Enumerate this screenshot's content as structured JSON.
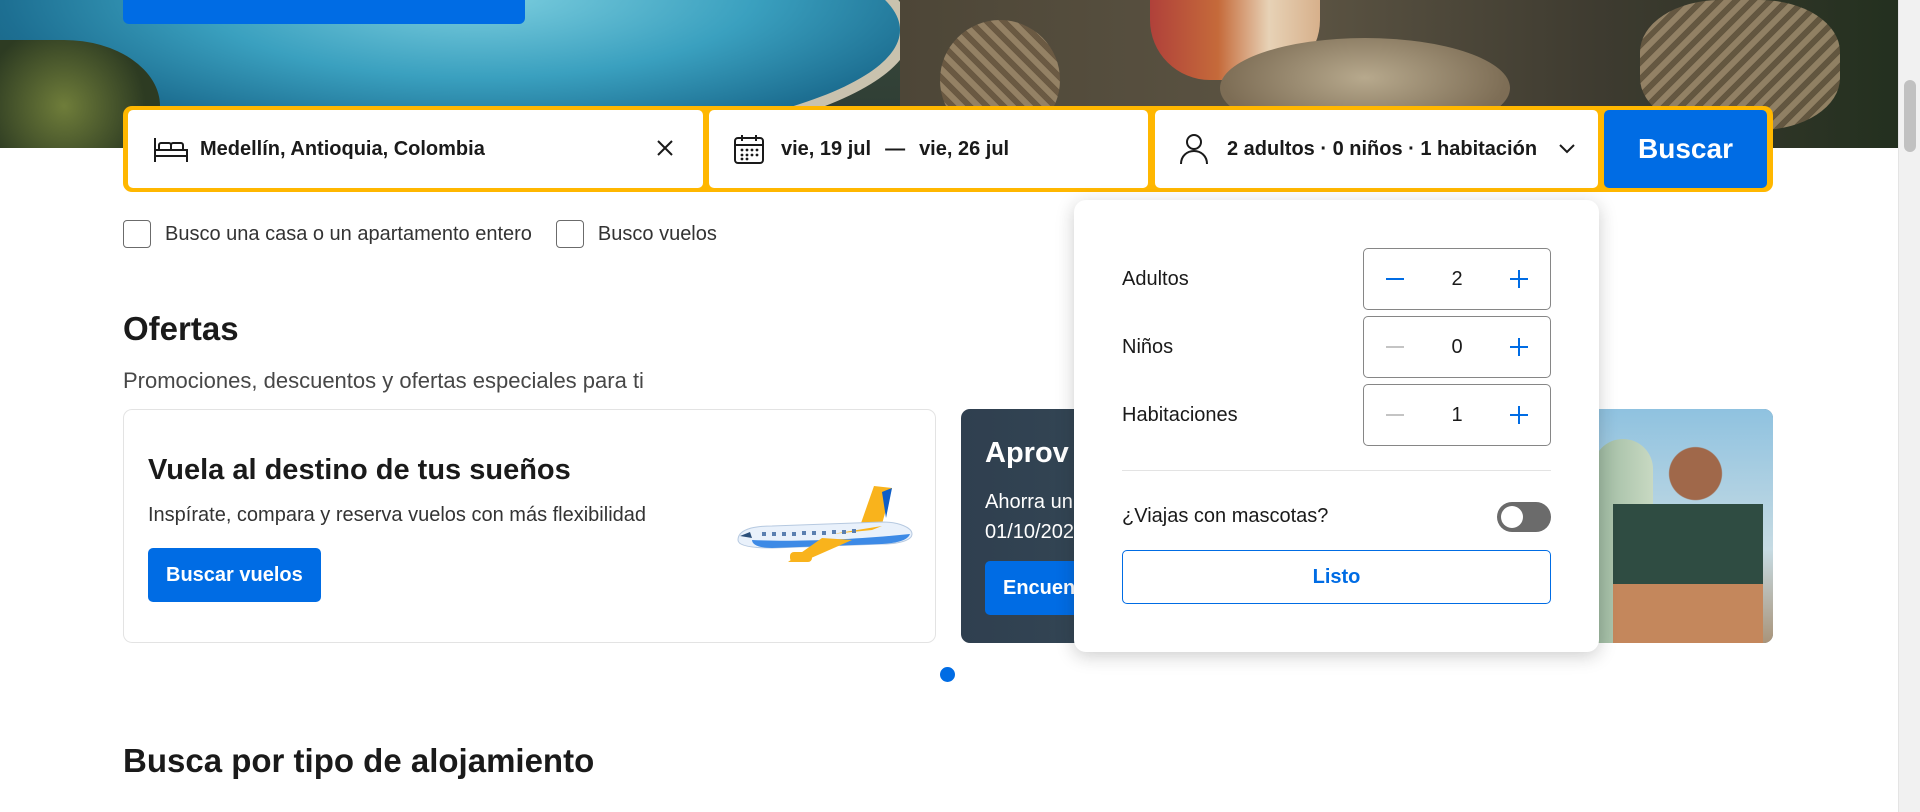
{
  "search": {
    "destination": "Medellín, Antioquia, Colombia",
    "checkin": "vie, 19 jul",
    "date_separator": "—",
    "checkout": "vie, 26 jul",
    "guests_summary": "2 adultos · 0 niños · 1 habitación",
    "search_label": "Buscar"
  },
  "filters": {
    "whole_home_label": "Busco una casa o un apartamento entero",
    "flights_label": "Busco vuelos"
  },
  "offers": {
    "title": "Ofertas",
    "subtitle": "Promociones, descuentos y ofertas especiales para ti",
    "card1": {
      "title": "Vuela al destino de tus sueños",
      "description": "Inspírate, compara y reserva vuelos con más flexibilidad",
      "button_label": "Buscar vuelos"
    },
    "card2": {
      "title_visible": "Aprov",
      "line1_visible": "Ahorra un",
      "line2_visible": "01/10/202",
      "button_label_visible": "Encuent"
    }
  },
  "section2": {
    "title": "Busca por tipo de alojamiento"
  },
  "guests_popover": {
    "adults": {
      "label": "Adultos",
      "value": "2"
    },
    "children": {
      "label": "Niños",
      "value": "0"
    },
    "rooms": {
      "label": "Habitaciones",
      "value": "1"
    },
    "pets_label": "¿Viajas con mascotas?",
    "pets_enabled": false,
    "done_label": "Listo"
  },
  "colors": {
    "brand_blue": "#006ce4",
    "search_border_yellow": "#ffb700",
    "text_dark": "#1a1a1a"
  },
  "icons": {
    "destination": "bed-icon",
    "clear": "close-icon",
    "dates": "calendar-icon",
    "guests": "person-icon",
    "dropdown": "chevron-down-icon",
    "decrement": "minus-icon",
    "increment": "plus-icon"
  }
}
